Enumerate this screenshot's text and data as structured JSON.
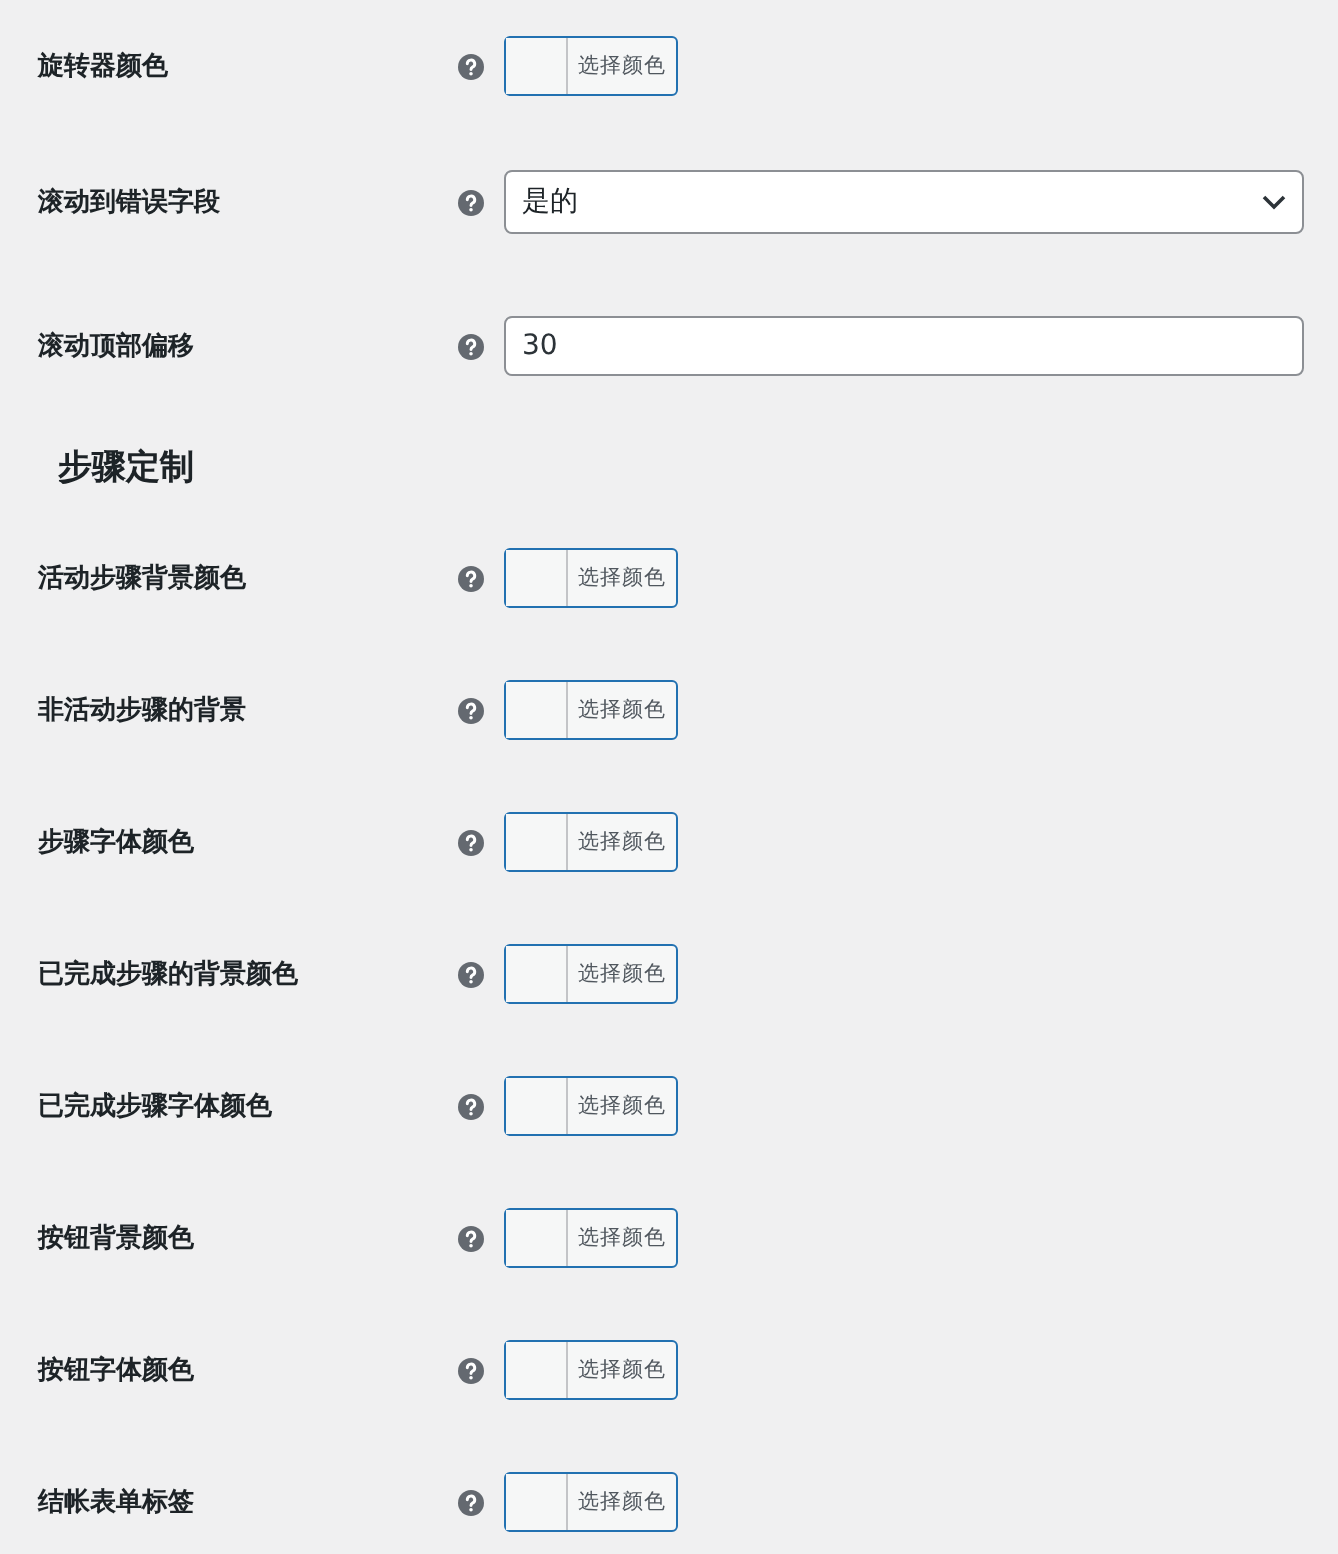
{
  "settings": [
    {
      "kind": "color",
      "label": "旋转器颜色",
      "button": "选择颜色"
    },
    {
      "kind": "select",
      "label": "滚动到错误字段",
      "value": "是的"
    },
    {
      "kind": "text",
      "label": "滚动顶部偏移",
      "value": "30"
    },
    {
      "kind": "heading",
      "label": "步骤定制"
    },
    {
      "kind": "color",
      "label": "活动步骤背景颜色",
      "button": "选择颜色"
    },
    {
      "kind": "color",
      "label": "非活动步骤的背景",
      "button": "选择颜色"
    },
    {
      "kind": "color",
      "label": "步骤字体颜色",
      "button": "选择颜色"
    },
    {
      "kind": "color",
      "label": "已完成步骤的背景颜色",
      "button": "选择颜色"
    },
    {
      "kind": "color",
      "label": "已完成步骤字体颜色",
      "button": "选择颜色"
    },
    {
      "kind": "color",
      "label": "按钮背景颜色",
      "button": "选择颜色"
    },
    {
      "kind": "color",
      "label": "按钮字体颜色",
      "button": "选择颜色"
    },
    {
      "kind": "color",
      "label": "结帐表单标签",
      "button": "选择颜色"
    }
  ]
}
